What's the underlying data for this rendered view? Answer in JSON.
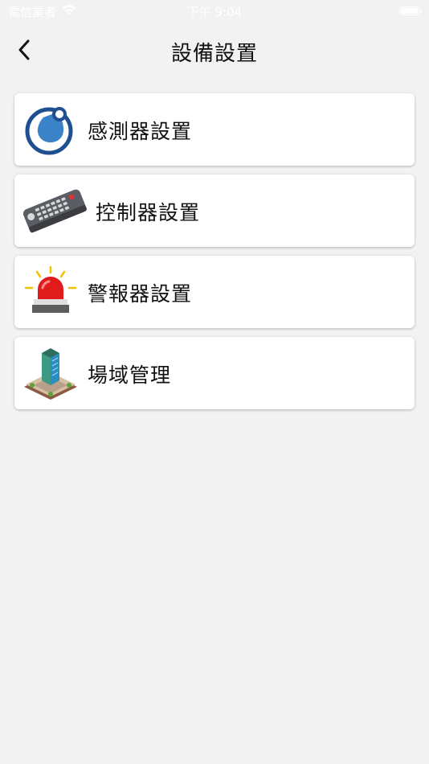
{
  "status_bar": {
    "carrier": "電信業者",
    "time": "下午 9:04"
  },
  "header": {
    "title": "設備設置"
  },
  "menu": {
    "items": [
      {
        "label": "感測器設置",
        "icon": "sensor-icon"
      },
      {
        "label": "控制器設置",
        "icon": "remote-control-icon"
      },
      {
        "label": "警報器設置",
        "icon": "alarm-siren-icon"
      },
      {
        "label": "場域管理",
        "icon": "building-icon"
      }
    ]
  },
  "colors": {
    "background": "#f2f2f2",
    "card": "#ffffff",
    "sensor_blue": "#1f4f8f",
    "alarm_red": "#e01b1b"
  }
}
